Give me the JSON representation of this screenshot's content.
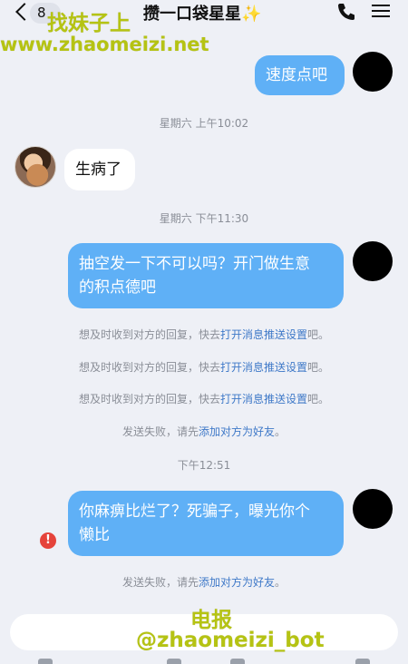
{
  "header": {
    "back_count": "8",
    "title": "攒一口袋星星✨",
    "phone_icon": "phone-icon",
    "menu_icon": "menu-icon"
  },
  "watermark": {
    "top_line1": "找妹子上",
    "top_line2": "www.zhaomeizi.net",
    "bottom_line1": "电报",
    "bottom_line2": "@zhaomeizi_bot"
  },
  "messages": {
    "m1": "速度点吧",
    "t1": "星期六 上午10:02",
    "m2": "生病了",
    "t2": "星期六 下午11:30",
    "m3_line1": "抽空发一下不可以吗？开门做生意",
    "m3_line2": "的积点德吧",
    "t3": "下午12:51",
    "m4_line1": "你麻痹比烂了？死骗子，曝光你个",
    "m4_line2": "懒比"
  },
  "notices": {
    "push_prefix": "想及时收到对方的回复，快去",
    "push_link": "打开消息推送设置",
    "push_suffix": "吧。",
    "fail_prefix": "发送失败，请先",
    "fail_link": "添加对方为好友",
    "fail_suffix": "。"
  },
  "error_icon": {
    "symbol": "!",
    "color": "#e5433b"
  },
  "colors": {
    "outgoing_bubble": "#5fb0f6",
    "incoming_bubble": "#ffffff",
    "background": "#eef0f6",
    "link": "#3f79c8"
  }
}
